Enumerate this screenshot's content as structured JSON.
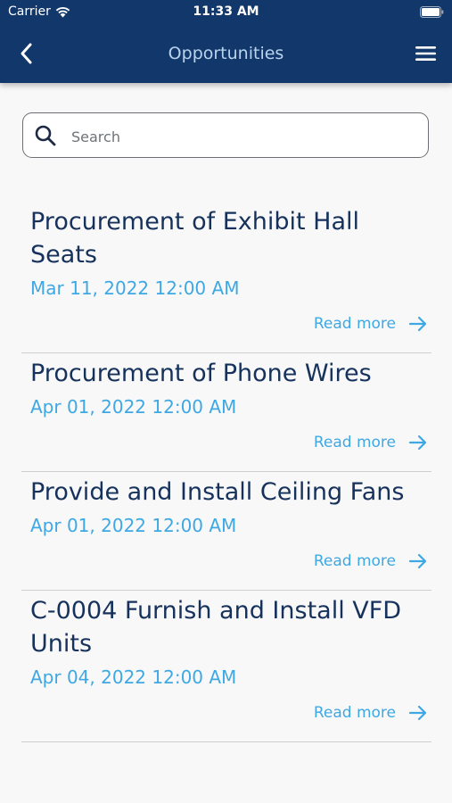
{
  "status_bar": {
    "carrier": "Carrier",
    "time": "11:33 AM"
  },
  "nav": {
    "title": "Opportunities",
    "back_icon": "chevron-left-icon",
    "menu_icon": "hamburger-menu-icon"
  },
  "search": {
    "placeholder": "Search",
    "value": ""
  },
  "opportunities": [
    {
      "title": "Procurement of Exhibit Hall Seats",
      "date": "Mar 11, 2022 12:00 AM",
      "link": "Read more"
    },
    {
      "title": "Procurement of Phone Wires",
      "date": "Apr 01, 2022 12:00 AM",
      "link": "Read more"
    },
    {
      "title": "Provide and Install Ceiling Fans",
      "date": "Apr 01, 2022 12:00 AM",
      "link": "Read more"
    },
    {
      "title": "C-0004 Furnish and Install VFD Units",
      "date": "Apr 04, 2022 12:00 AM",
      "link": "Read more"
    }
  ],
  "colors": {
    "header": "#12386b",
    "title": "#16325c",
    "accent": "#3ea8e4",
    "nav_title": "#b9d3ee"
  }
}
